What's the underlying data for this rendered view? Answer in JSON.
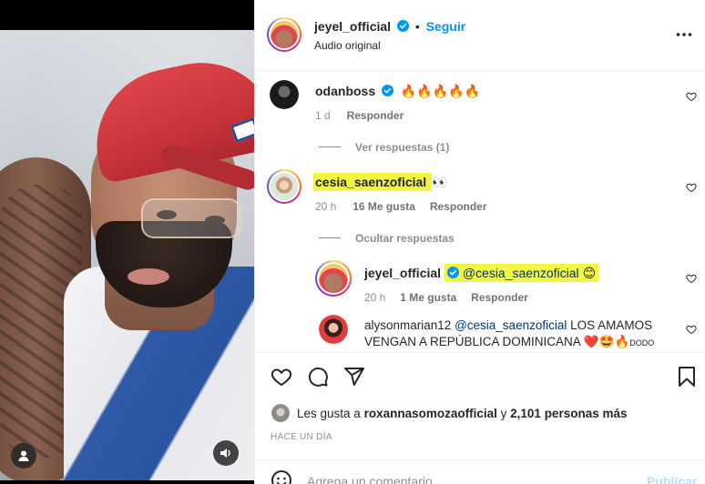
{
  "post": {
    "username": "jeyel_official",
    "follow_label": "Seguir",
    "audio": "Audio original",
    "separator": "•"
  },
  "comments": [
    {
      "user": "odanboss",
      "text": "🔥🔥🔥🔥🔥",
      "age": "1 d",
      "reply": "Responder",
      "view_replies": "Ver respuestas (1)"
    },
    {
      "user": "cesia_saenzoficial",
      "text": "👀",
      "age": "20 h",
      "likes": "16 Me gusta",
      "reply": "Responder",
      "hide_replies": "Ocultar respuestas",
      "replies": [
        {
          "user": "jeyel_official",
          "mention": "@cesia_saenzoficial",
          "text": "😊",
          "age": "20 h",
          "likes": "1 Me gusta",
          "reply": "Responder"
        },
        {
          "user": "alysonmarian12",
          "mention": "@cesia_saenzoficial",
          "text": "LOS AMAMOS VENGAN A REPÚBLICA DOMINICANA",
          "emoji": "❤️🤩🔥",
          "tail": "DODO"
        }
      ]
    }
  ],
  "likes": {
    "prefix": "Les gusta a",
    "user": "roxannasomozaofficial",
    "joiner": "y",
    "others": "2,101 personas más"
  },
  "time_ago": "HACE UN DÍA",
  "composer": {
    "placeholder": "Agrega un comentario...",
    "publish": "Publicar"
  },
  "colors": {
    "accent": "#0095f6",
    "highlight": "#f2f542",
    "mention": "#00376b"
  }
}
